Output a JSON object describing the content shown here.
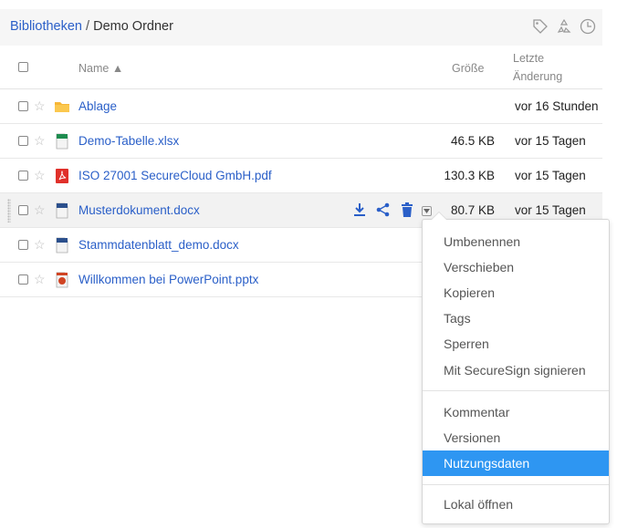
{
  "breadcrumb": {
    "root": "Bibliotheken",
    "separator": " / ",
    "current": "Demo Ordner"
  },
  "header_icons": [
    "tag-icon",
    "recycle-icon",
    "history-icon"
  ],
  "table": {
    "col_name": "Name ▲",
    "col_size": "Größe",
    "col_modified_1": "Letzte",
    "col_modified_2": "Änderung"
  },
  "files": [
    {
      "name": "Ablage",
      "size": "",
      "modified": "vor 16 Stunden",
      "icon": "folder-icon"
    },
    {
      "name": "Demo-Tabelle.xlsx",
      "size": "46.5 KB",
      "modified": "vor 15 Tagen",
      "icon": "excel-file-icon"
    },
    {
      "name": "ISO 27001 SecureCloud GmbH.pdf",
      "size": "130.3 KB",
      "modified": "vor 15 Tagen",
      "icon": "pdf-file-icon"
    },
    {
      "name": "Musterdokument.docx",
      "size": "80.7 KB",
      "modified": "vor 15 Tagen",
      "icon": "word-file-icon"
    },
    {
      "name": "Stammdatenblatt_demo.docx",
      "size": "",
      "modified": "",
      "icon": "word-file-icon"
    },
    {
      "name": "Willkommen bei PowerPoint.pptx",
      "size": "",
      "modified": "",
      "icon": "powerpoint-file-icon"
    }
  ],
  "row_actions": [
    "download-icon",
    "share-icon",
    "delete-icon",
    "dropdown-toggle"
  ],
  "menu": {
    "group1": [
      "Umbenennen",
      "Verschieben",
      "Kopieren",
      "Tags",
      "Sperren",
      "Mit SecureSign signieren"
    ],
    "group2": [
      "Kommentar",
      "Versionen",
      "Nutzungsdaten"
    ],
    "group3": [
      "Lokal öffnen"
    ],
    "active": "Nutzungsdaten"
  },
  "colors": {
    "link": "#2a5fc8",
    "menu_active": "#2e96f2",
    "header_bg": "#f6f6f6",
    "hover_row": "#f2f2f2"
  }
}
